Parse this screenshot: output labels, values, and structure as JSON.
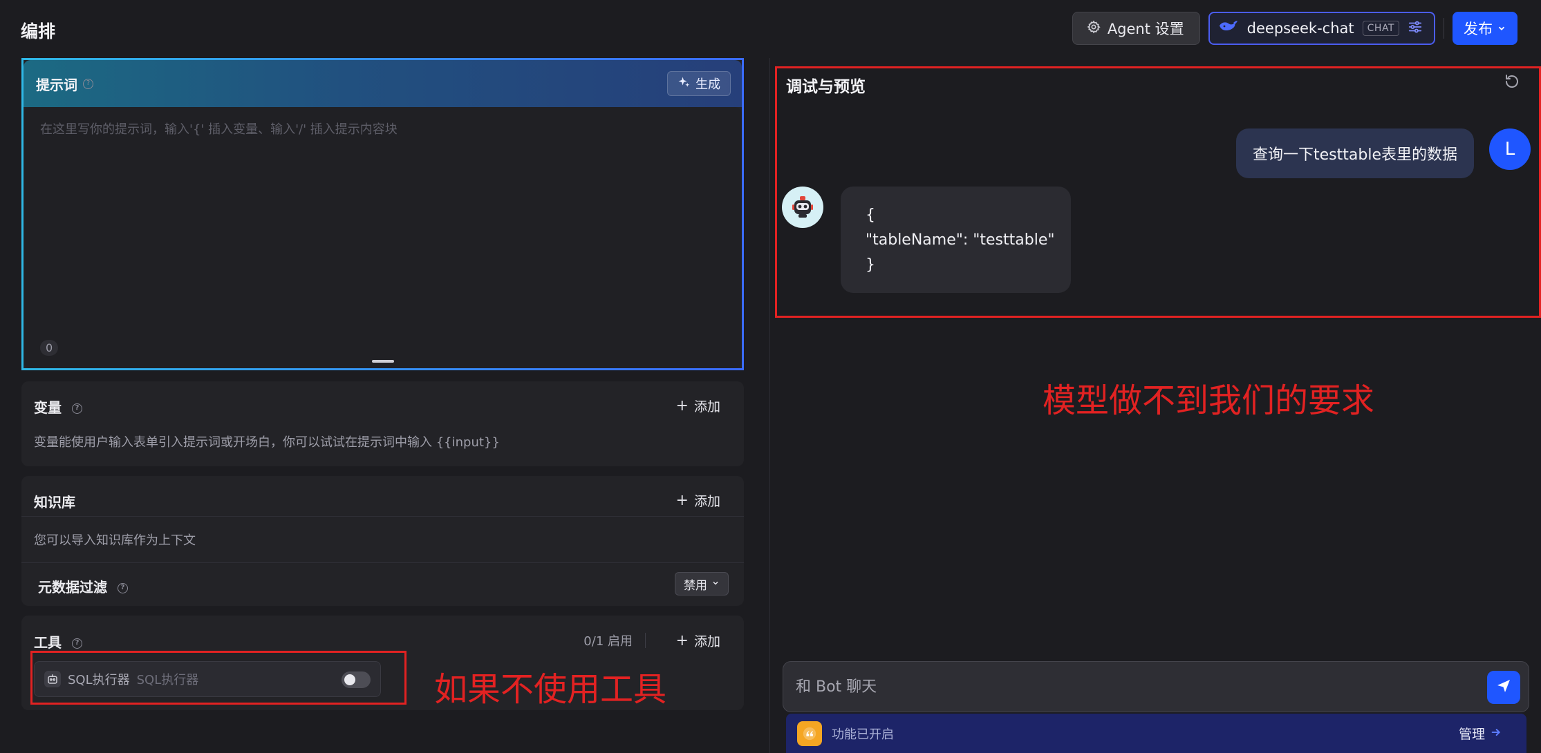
{
  "page": {
    "title": "编排"
  },
  "topbar": {
    "agent_settings_label": "Agent 设置",
    "model_name": "deepseek-chat",
    "model_badge": "CHAT",
    "publish_label": "发布"
  },
  "prompt": {
    "title": "提示词",
    "generate_label": "生成",
    "placeholder": "在这里写你的提示词，输入'{' 插入变量、输入'/' 插入提示内容块",
    "char_count": "0"
  },
  "variables": {
    "title": "变量",
    "add_label": "添加",
    "description": "变量能使用户输入表单引入提示词或开场白，你可以试试在提示词中输入 {{input}}"
  },
  "knowledge": {
    "title": "知识库",
    "add_label": "添加",
    "description": "您可以导入知识库作为上下文",
    "meta_filter_title": "元数据过滤",
    "meta_filter_value": "禁用"
  },
  "tools": {
    "title": "工具",
    "enabled_count": "0/1 启用",
    "add_label": "添加",
    "items": [
      {
        "name": "SQL执行器",
        "description": "SQL执行器",
        "enabled": false
      }
    ]
  },
  "preview": {
    "title": "调试与预览",
    "user_avatar_letter": "L",
    "user_message": "查询一下testtable表里的数据",
    "bot_message": "{\n\"tableName\": \"testtable\"\n}",
    "input_placeholder": "和 Bot 聊天",
    "feature_status": "功能已开启",
    "manage_label": "管理"
  },
  "annotations": {
    "right_note": "模型做不到我们的要求",
    "left_note": "如果不使用工具"
  },
  "colors": {
    "background": "#1c1c20",
    "accent": "#1f56ff",
    "annotation_red": "#e22222",
    "feature_bar": "#1d2468"
  }
}
